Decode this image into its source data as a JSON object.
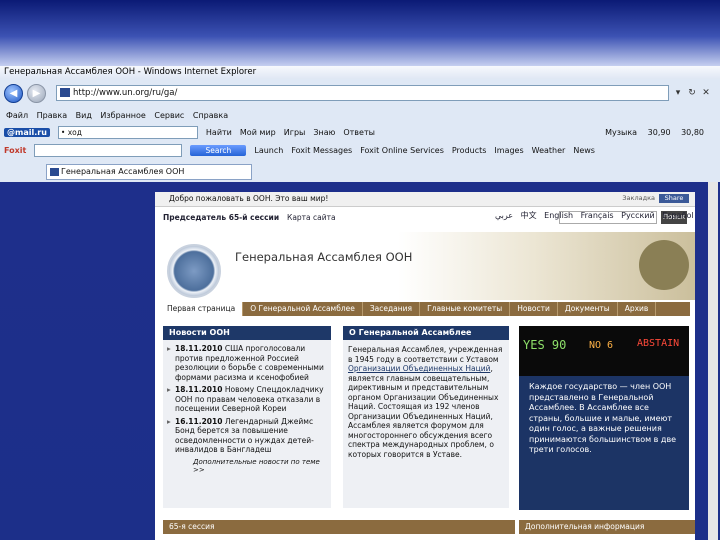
{
  "window": {
    "title": "Генеральная Ассамблея ООН - Windows Internet Explorer"
  },
  "address": {
    "url": "http://www.un.org/ru/ga/"
  },
  "menu": [
    "Файл",
    "Правка",
    "Вид",
    "Избранное",
    "Сервис",
    "Справка"
  ],
  "toolbar_mail": {
    "logo": "@mail.ru",
    "search_text": "• ход",
    "find": "Найти",
    "items": [
      "Мой мир",
      "Игры",
      "Знаю",
      "Ответы"
    ],
    "right": [
      "Музыка",
      "30,90",
      "30,80"
    ]
  },
  "toolbar_foxit": {
    "logo": "Foxit",
    "search_button": "Search",
    "items": [
      "Launch",
      "Foxit Messages",
      "Foxit Online Services",
      "Products",
      "Images",
      "Weather",
      "News"
    ]
  },
  "tab": {
    "title": "Генеральная Ассамблея ООН"
  },
  "page": {
    "banner": "Добро пожаловать в ООН. Это ваш мир!",
    "share": "Share",
    "bookmark": "Закладка",
    "president": "Председатель 65-й сессии",
    "sitemap": "Карта сайта",
    "search_button": "Поиск",
    "languages": "عربي 中文 English Français Русский Español",
    "header_title": "Генеральная Ассамблея ООН",
    "nav": [
      "Первая страница",
      "О Генеральной Ассамблее",
      "Заседания",
      "Главные комитеты",
      "Новости",
      "Документы",
      "Архив"
    ],
    "news_heading": "Новости ООН",
    "news": [
      {
        "date": "18.11.2010",
        "text": "США проголосовали против предложенной Россией резолюции о борьбе с современными формами расизма и ксенофобией"
      },
      {
        "date": "18.11.2010",
        "text": "Новому Спецдокладчику ООН по правам человека отказали в посещении Северной Кореи"
      },
      {
        "date": "16.11.2010",
        "text": "Легендарный Джеймс Бонд берется за повышение осведомленности о нуждах детей-инвалидов в Бангладеш"
      }
    ],
    "more_news": "Дополнительные новости по теме >>",
    "ga_heading": "О Генеральной Ассамблее",
    "ga_text_1": "Генеральная Ассамблея, учрежденная в 1945 году в соответствии с Уставом ",
    "ga_link": "Организации Объединенных Наций",
    "ga_text_2": ", является главным совещательным, директивным и представительным органом Организации Объединенных Наций. Состоящая из 192 членов Организации Объединенных Наций, Ассамблея является форумом для многостороннего обсуждения всего спектра международных проблем, о которых говорится в Уставе.",
    "vote_board": {
      "yes": "YES 90",
      "no": "NO 6",
      "abstain": "ABSTAIN"
    },
    "quote": "Каждое государство — член ООН представлено в Генеральной Ассамблее. В Ассамблее все страны, большие и малые, имеют один голос, а важные решения принимаются большинством в две трети голосов.",
    "footer_left": "65-я сессия",
    "footer_right": "Дополнительная информация"
  }
}
